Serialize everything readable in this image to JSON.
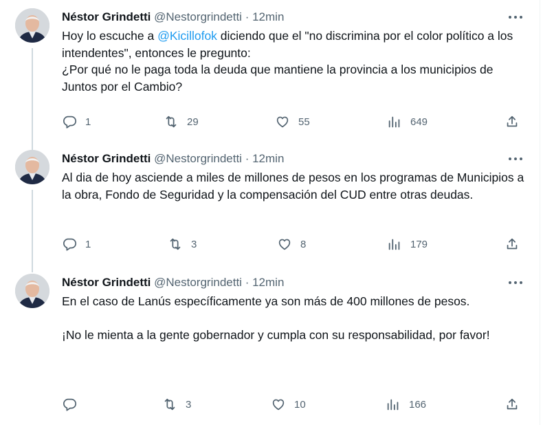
{
  "tweets": [
    {
      "author": {
        "name": "Néstor Grindetti",
        "handle": "@Nestorgrindetti",
        "time": "12min"
      },
      "separator": "·",
      "mention": "@Kicillofok",
      "text_before_mention": "Hoy lo escuche a ",
      "text_after_mention": " diciendo que el \"no discrimina por el color político a los intendentes\", entonces le pregunto:",
      "text_line2": "¿Por qué no le paga toda la deuda que mantiene la provincia a los municipios de Juntos por el Cambio?",
      "replies": "1",
      "retweets": "29",
      "likes": "55",
      "views": "649"
    },
    {
      "author": {
        "name": "Néstor Grindetti",
        "handle": "@Nestorgrindetti",
        "time": "12min"
      },
      "separator": "·",
      "text": "Al dia de hoy asciende a miles de millones de pesos en los programas de Municipios a la obra, Fondo de Seguridad y la compensación del CUD entre otras deudas.",
      "replies": "1",
      "retweets": "3",
      "likes": "8",
      "views": "179"
    },
    {
      "author": {
        "name": "Néstor Grindetti",
        "handle": "@Nestorgrindetti",
        "time": "12min"
      },
      "separator": "·",
      "text_p1": "En el caso de Lanús específicamente ya son más de 400 millones de pesos.",
      "text_p2": "¡No le mienta a la gente gobernador y cumpla con su responsabilidad, por favor!",
      "replies": "",
      "retweets": "3",
      "likes": "10",
      "views": "166"
    }
  ],
  "colors": {
    "text": "#0f1419",
    "secondary": "#536471",
    "link": "#1d9bf0",
    "thread_line": "#cfd9de"
  },
  "icons": [
    "more-icon",
    "reply-icon",
    "retweet-icon",
    "like-icon",
    "views-icon",
    "share-icon"
  ]
}
